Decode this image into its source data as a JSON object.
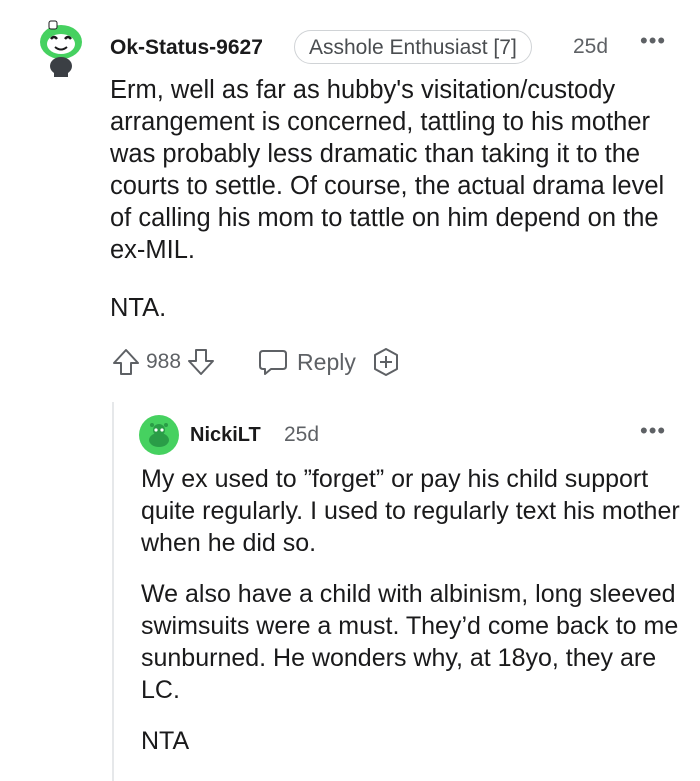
{
  "comment": {
    "username": "Ok-Status-9627",
    "flair": "Asshole Enthusiast [7]",
    "time": "25d",
    "more": "•••",
    "paragraphs": [
      "Erm, well as far as hubby's visitation/custody arrangement is concerned, tattling to his mother was probably less dramatic than taking it to the courts to settle. Of course, the actual drama level of calling his mom to tattle on him depend on the ex-MIL.",
      "NTA."
    ],
    "score": "988",
    "reply_label": "Reply"
  },
  "reply": {
    "username": "NickiLT",
    "time": "25d",
    "more": "•••",
    "paragraphs": [
      "My ex used to ”forget” or pay his child support quite regularly. I used to regularly text his mother when he did so.",
      "We also have a child with albinism, long sleeved swimsuits were a must. They’d come back to me sunburned. He wonders why, at 18yo, they are LC.",
      "NTA"
    ]
  },
  "colors": {
    "text": "#1a1a1b",
    "meta": "#5e6165",
    "avatar1_green": "#46d160",
    "avatar2_green": "#46d160"
  },
  "icons": {
    "upvote": "upvote-arrow-icon",
    "downvote": "downvote-arrow-icon",
    "reply": "speech-bubble-icon",
    "award": "award-plus-icon"
  }
}
